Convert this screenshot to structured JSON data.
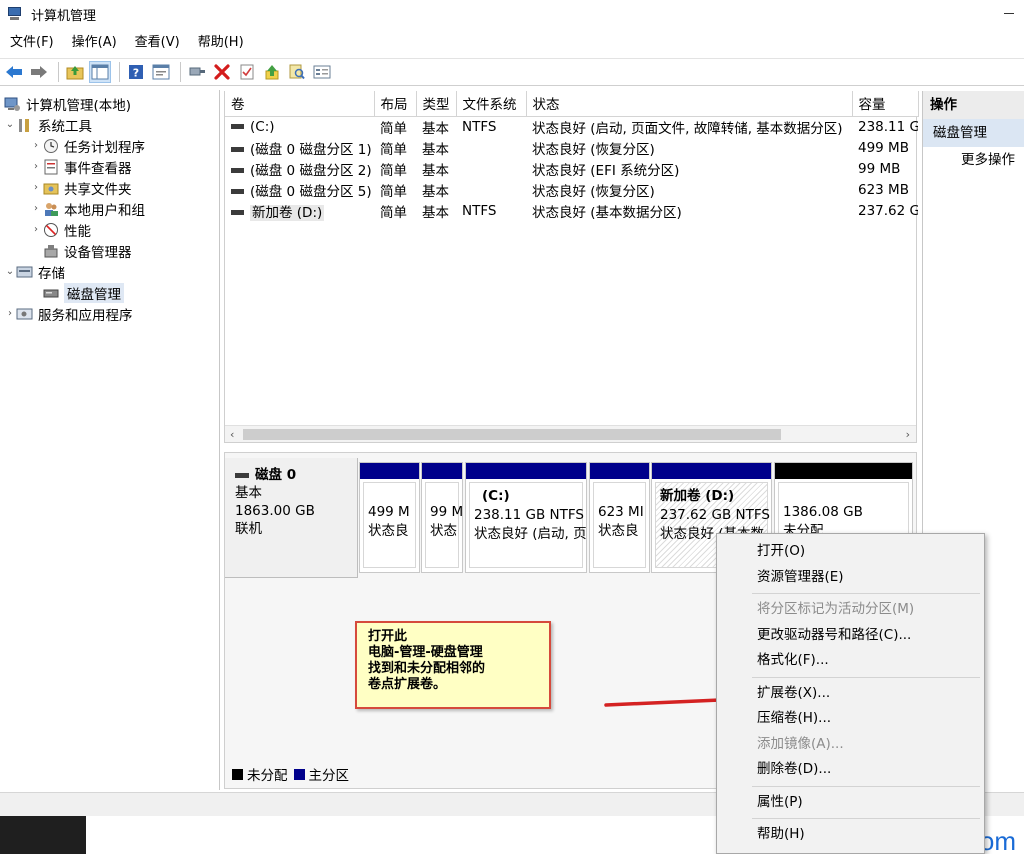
{
  "window": {
    "title": "计算机管理"
  },
  "menu": [
    "文件(F)",
    "操作(A)",
    "查看(V)",
    "帮助(H)"
  ],
  "toolbar": {
    "icons": [
      "back-arrow-icon",
      "forward-arrow-icon",
      "up-folder-icon",
      "show-hide-tree-icon",
      "help-icon",
      "properties-view-icon",
      "connect-icon",
      "delete-icon",
      "checklist-icon",
      "up-arrow-icon",
      "search-icon",
      "settings-icon"
    ]
  },
  "tree": {
    "root": "计算机管理(本地)",
    "system_tools": "系统工具",
    "task_scheduler": "任务计划程序",
    "event_viewer": "事件查看器",
    "shared_folders": "共享文件夹",
    "local_users": "本地用户和组",
    "performance": "性能",
    "device_manager": "设备管理器",
    "storage": "存储",
    "disk_management": "磁盘管理",
    "services": "服务和应用程序"
  },
  "volumes": {
    "headers": [
      "卷",
      "布局",
      "类型",
      "文件系统",
      "状态",
      "容量"
    ],
    "rows": [
      [
        "(C:)",
        "简单",
        "基本",
        "NTFS",
        "状态良好 (启动, 页面文件, 故障转储, 基本数据分区)",
        "238.11 G"
      ],
      [
        "(磁盘 0 磁盘分区 1)",
        "简单",
        "基本",
        "",
        "状态良好 (恢复分区)",
        "499 MB"
      ],
      [
        "(磁盘 0 磁盘分区 2)",
        "简单",
        "基本",
        "",
        "状态良好 (EFI 系统分区)",
        "99 MB"
      ],
      [
        "(磁盘 0 磁盘分区 5)",
        "简单",
        "基本",
        "",
        "状态良好 (恢复分区)",
        "623 MB"
      ],
      [
        "新加卷 (D:)",
        "简单",
        "基本",
        "NTFS",
        "状态良好 (基本数据分区)",
        "237.62 G"
      ]
    ]
  },
  "disk": {
    "name": "磁盘 0",
    "type": "基本",
    "size": "1863.00 GB",
    "status": "联机",
    "partitions": [
      {
        "title": "",
        "line1": "499 M",
        "line2": "状态良"
      },
      {
        "title": "",
        "line1": "99 M",
        "line2": "状态"
      },
      {
        "title": "(C:)",
        "line1": "238.11 GB NTFS",
        "line2": "状态良好 (启动, 页"
      },
      {
        "title": "",
        "line1": "623 MI",
        "line2": "状态良"
      },
      {
        "title": "新加卷 (D:)",
        "line1": "237.62 GB NTFS",
        "line2": "状态良好 (基本数"
      },
      {
        "title": "",
        "line1": "1386.08 GB",
        "line2": "未分配"
      }
    ]
  },
  "legend": {
    "unallocated": "未分配",
    "primary": "主分区",
    "unallocated_color": "#000000",
    "primary_color": "#00008b"
  },
  "actions": {
    "header": "操作",
    "selected": "磁盘管理",
    "more": "更多操作"
  },
  "note": {
    "lines": [
      "打开此",
      "电脑-管理-硬盘管理",
      "找到和未分配相邻的",
      "卷点扩展卷。"
    ]
  },
  "context_menu": {
    "open": "打开(O)",
    "explorer": "资源管理器(E)",
    "mark_active": "将分区标记为活动分区(M)",
    "change_letter": "更改驱动器号和路径(C)...",
    "format": "格式化(F)...",
    "extend": "扩展卷(X)...",
    "shrink": "压缩卷(H)...",
    "add_mirror": "添加镜像(A)...",
    "delete": "删除卷(D)...",
    "properties": "属性(P)",
    "help": "帮助(H)"
  },
  "watermark": "xxshell.com",
  "colors": {
    "primary_partition": "#00008b",
    "annotation_border": "#d54a3c",
    "annotation_bg": "#ffffc4",
    "arrow": "#d42222",
    "watermark": "#1a6bd6"
  }
}
